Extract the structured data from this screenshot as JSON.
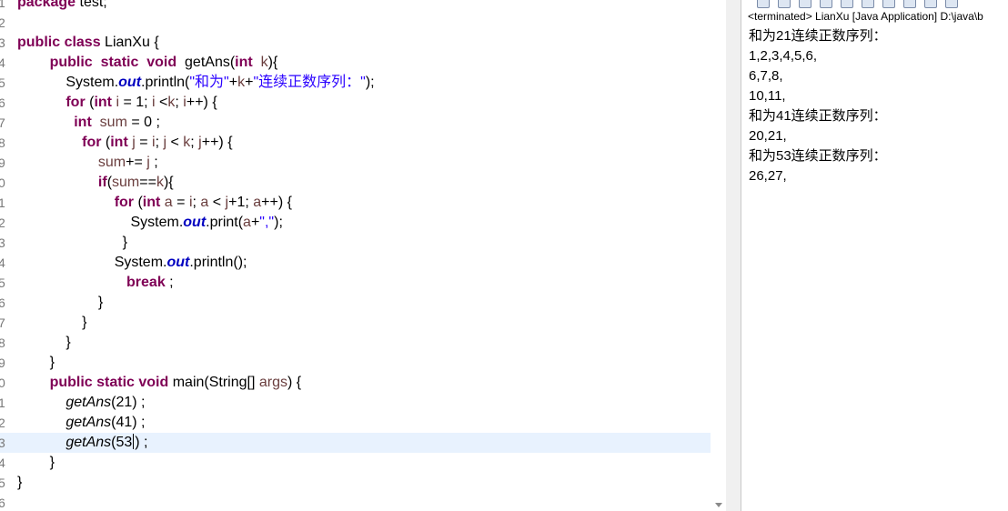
{
  "editor": {
    "line_numbers": [
      "1",
      "2",
      "3",
      "4",
      "5",
      "6",
      "7",
      "8",
      "9",
      "0",
      "1",
      "2",
      "3",
      "4",
      "5",
      "6",
      "7",
      "8",
      "9",
      "0",
      "1",
      "2",
      "3",
      "4",
      "5",
      "6"
    ],
    "lines": [
      {
        "parts": [
          [
            "kw",
            "package"
          ],
          [
            "t",
            " test;"
          ]
        ]
      },
      {
        "parts": []
      },
      {
        "parts": [
          [
            "kw",
            "public"
          ],
          [
            "t",
            " "
          ],
          [
            "kw",
            "class"
          ],
          [
            "t",
            " LianXu {"
          ]
        ]
      },
      {
        "parts": [
          [
            "t",
            "        "
          ],
          [
            "kw",
            "public"
          ],
          [
            "t",
            "  "
          ],
          [
            "kw",
            "static"
          ],
          [
            "t",
            "  "
          ],
          [
            "kw",
            "void"
          ],
          [
            "t",
            "  getAns("
          ],
          [
            "kw",
            "int"
          ],
          [
            "t",
            "  "
          ],
          [
            "var",
            "k"
          ],
          [
            "t",
            "){"
          ]
        ]
      },
      {
        "parts": [
          [
            "t",
            "            System."
          ],
          [
            "fld",
            "out"
          ],
          [
            "t",
            ".println("
          ],
          [
            "str",
            "\"和为\""
          ],
          [
            "t",
            "+"
          ],
          [
            "var",
            "k"
          ],
          [
            "t",
            "+"
          ],
          [
            "str",
            "\"连续正数序列：\""
          ],
          [
            "t",
            ");"
          ]
        ]
      },
      {
        "parts": [
          [
            "t",
            "            "
          ],
          [
            "kw",
            "for"
          ],
          [
            "t",
            " ("
          ],
          [
            "kw",
            "int"
          ],
          [
            "t",
            " "
          ],
          [
            "var",
            "i"
          ],
          [
            "t",
            " = 1; "
          ],
          [
            "var",
            "i"
          ],
          [
            "t",
            " <"
          ],
          [
            "var",
            "k"
          ],
          [
            "t",
            "; "
          ],
          [
            "var",
            "i"
          ],
          [
            "t",
            "++) {"
          ]
        ]
      },
      {
        "parts": [
          [
            "t",
            "              "
          ],
          [
            "kw",
            "int"
          ],
          [
            "t",
            "  "
          ],
          [
            "var",
            "sum"
          ],
          [
            "t",
            " = 0 ;"
          ]
        ]
      },
      {
        "parts": [
          [
            "t",
            "                "
          ],
          [
            "kw",
            "for"
          ],
          [
            "t",
            " ("
          ],
          [
            "kw",
            "int"
          ],
          [
            "t",
            " "
          ],
          [
            "var",
            "j"
          ],
          [
            "t",
            " = "
          ],
          [
            "var",
            "i"
          ],
          [
            "t",
            "; "
          ],
          [
            "var",
            "j"
          ],
          [
            "t",
            " < "
          ],
          [
            "var",
            "k"
          ],
          [
            "t",
            "; "
          ],
          [
            "var",
            "j"
          ],
          [
            "t",
            "++) {"
          ]
        ]
      },
      {
        "parts": [
          [
            "t",
            "                    "
          ],
          [
            "var",
            "sum"
          ],
          [
            "t",
            "+= "
          ],
          [
            "var",
            "j"
          ],
          [
            "t",
            " ;"
          ]
        ]
      },
      {
        "parts": [
          [
            "t",
            "                    "
          ],
          [
            "kw",
            "if"
          ],
          [
            "t",
            "("
          ],
          [
            "var",
            "sum"
          ],
          [
            "t",
            "=="
          ],
          [
            "var",
            "k"
          ],
          [
            "t",
            "){"
          ]
        ]
      },
      {
        "parts": [
          [
            "t",
            "                        "
          ],
          [
            "kw",
            "for"
          ],
          [
            "t",
            " ("
          ],
          [
            "kw",
            "int"
          ],
          [
            "t",
            " "
          ],
          [
            "var",
            "a"
          ],
          [
            "t",
            " = "
          ],
          [
            "var",
            "i"
          ],
          [
            "t",
            "; "
          ],
          [
            "var",
            "a"
          ],
          [
            "t",
            " < "
          ],
          [
            "var",
            "j"
          ],
          [
            "t",
            "+1; "
          ],
          [
            "var",
            "a"
          ],
          [
            "t",
            "++) {"
          ]
        ]
      },
      {
        "parts": [
          [
            "t",
            "                            System."
          ],
          [
            "fld",
            "out"
          ],
          [
            "t",
            ".print("
          ],
          [
            "var",
            "a"
          ],
          [
            "t",
            "+"
          ],
          [
            "str",
            "\",\""
          ],
          [
            "t",
            ");"
          ]
        ]
      },
      {
        "parts": [
          [
            "t",
            "                          }"
          ]
        ]
      },
      {
        "parts": [
          [
            "t",
            "                        System."
          ],
          [
            "fld",
            "out"
          ],
          [
            "t",
            ".println();"
          ]
        ]
      },
      {
        "parts": [
          [
            "t",
            "                           "
          ],
          [
            "kw",
            "break"
          ],
          [
            "t",
            " ;"
          ]
        ]
      },
      {
        "parts": [
          [
            "t",
            "                    }"
          ]
        ]
      },
      {
        "parts": [
          [
            "t",
            "                }"
          ]
        ]
      },
      {
        "parts": [
          [
            "t",
            "            }"
          ]
        ]
      },
      {
        "parts": [
          [
            "t",
            "        }"
          ]
        ]
      },
      {
        "parts": [
          [
            "t",
            "        "
          ],
          [
            "kw",
            "public"
          ],
          [
            "t",
            " "
          ],
          [
            "kw",
            "static"
          ],
          [
            "t",
            " "
          ],
          [
            "kw",
            "void"
          ],
          [
            "t",
            " main(String[] "
          ],
          [
            "var",
            "args"
          ],
          [
            "t",
            ") {"
          ]
        ]
      },
      {
        "parts": [
          [
            "t",
            "            "
          ],
          [
            "mcall",
            "getAns"
          ],
          [
            "t",
            "(21) ;"
          ]
        ]
      },
      {
        "parts": [
          [
            "t",
            "            "
          ],
          [
            "mcall",
            "getAns"
          ],
          [
            "t",
            "(41) ;"
          ]
        ]
      },
      {
        "parts": [
          [
            "t",
            "            "
          ],
          [
            "mcall",
            "getAns"
          ],
          [
            "t",
            "(53"
          ],
          [
            "caret",
            ""
          ],
          [
            "t",
            ") ;"
          ]
        ]
      },
      {
        "parts": [
          [
            "t",
            "        }"
          ]
        ]
      },
      {
        "parts": [
          [
            "t",
            "}"
          ]
        ]
      },
      {
        "parts": []
      }
    ],
    "current_line": 22
  },
  "console": {
    "title": "<terminated> LianXu [Java Application] D:\\java\\b",
    "output": [
      "和为21连续正数序列：",
      "1,2,3,4,5,6,",
      "6,7,8,",
      "10,11,",
      "和为41连续正数序列：",
      "20,21,",
      "和为53连续正数序列：",
      "26,27,"
    ],
    "toolbar_icons": [
      "remove-launch-icon",
      "remove-all-icon",
      "clear-console-icon",
      "scroll-lock-icon",
      "word-wrap-icon",
      "pin-console-icon",
      "display-console-icon",
      "open-console-icon",
      "minimize-icon",
      "maximize-icon"
    ]
  }
}
